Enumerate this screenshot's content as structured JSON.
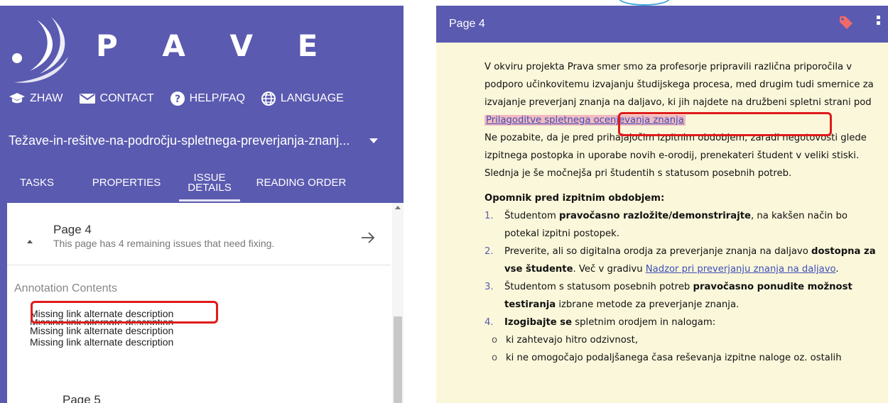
{
  "app": {
    "brand": "P A V E",
    "colors": {
      "primary": "#5a5ab0",
      "highlight": "#e01b1b",
      "doc_bg": "#fbf7da",
      "link": "#3d4fb8"
    }
  },
  "nav": {
    "items": [
      {
        "label": "ZHAW",
        "icon": "graduation-cap-icon"
      },
      {
        "label": "CONTACT",
        "icon": "mail-icon"
      },
      {
        "label": "HELP/FAQ",
        "icon": "help-circle-icon"
      },
      {
        "label": "LANGUAGE",
        "icon": "globe-icon"
      }
    ]
  },
  "document": {
    "selected": "Težave-in-rešitve-na-področju-spletnega-preverjanja-znanj..."
  },
  "tabs": [
    {
      "label": "TASKS"
    },
    {
      "label": "PROPERTIES"
    },
    {
      "label": "ISSUE DETAILS",
      "line1": "ISSUE",
      "line2": "DETAILS",
      "active": true
    },
    {
      "label": "READING ORDER"
    }
  ],
  "issues": {
    "page_title": "Page 4",
    "page_subtitle": "This page has 4 remaining issues that need fixing.",
    "annotation_title": "Annotation Contents",
    "annotations": [
      "Missing link alternate description",
      "Missing link alternate description",
      "Missing link alternate description",
      "Missing link alternate description"
    ],
    "next_page_title": "Page 5"
  },
  "viewer": {
    "page_label": "Page 4",
    "para1_pre": "V okviru projekta Prava smer smo za profesorje pripravili različna priporočila v podporo učinkovitemu izvajanju študijskega procesa, med drugim tudi smernice za izvajanje preverjanj znanja na daljavo, ki jih najdete na družbeni spletni strani pod ",
    "para1_link": "Prilagoditve spletnega ocenjevanja znanja",
    "para2": "Ne pozabite, da je pred prihajajočim izpitnim obdobjem, zaradi negotovosti glede izpitnega postopka in uporabe novih e-orodij, prenekateri študent v veliki stiski. Slednja je še močnejša pri študentih s statusom posebnih potreb.",
    "section_heading": "Opomnik pred izpitnim obdobjem:",
    "list": [
      {
        "num": "1.",
        "pre": "Študentom ",
        "bold": "pravočasno razložite/demonstrirajte",
        "post": ", na kakšen način bo potekal izpitni postopek."
      },
      {
        "num": "2.",
        "pre": "Preverite, ali so digitalna orodja za preverjanje znanja na daljavo ",
        "bold": "dostopna za vse študente",
        "post": ". Več v gradivu ",
        "link": "Nadzor pri preverjanju znanja na daljavo",
        "tail": "."
      },
      {
        "num": "3.",
        "pre": "Študentom s statusom posebnih potreb ",
        "bold": "pravočasno ponudite možnost testiranja",
        "post": " izbrane metode za preverjanje znanja."
      },
      {
        "num": "4.",
        "pre": "",
        "bold": "Izogibajte se",
        "post": " spletnim orodjem in nalogam:"
      }
    ],
    "sublist": [
      "ki zahtevajo hitro odzivnost,",
      "ki ne omogočajo podaljšanega časa reševanja izpitne naloge oz. ostalih"
    ]
  }
}
